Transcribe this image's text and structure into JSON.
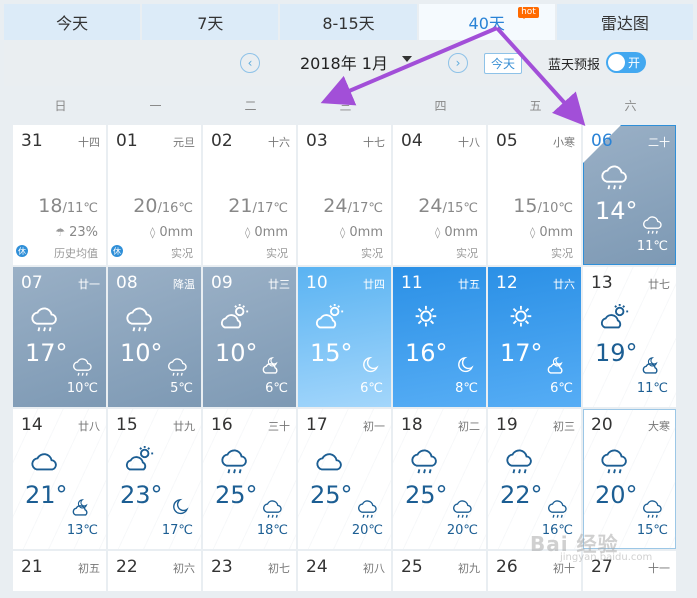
{
  "tabs": [
    {
      "label": "今天",
      "active": false
    },
    {
      "label": "7天",
      "active": false
    },
    {
      "label": "8-15天",
      "active": false
    },
    {
      "label": "40天",
      "active": true,
      "badge": "hot"
    },
    {
      "label": "雷达图",
      "active": false
    }
  ],
  "toolbar": {
    "prev_icon": "chevron-left-icon",
    "next_icon": "chevron-right-icon",
    "month": "2018年  1月",
    "today_label": "今天",
    "bluesky_label": "蓝天预报",
    "toggle_label": "开",
    "toggle_on": true
  },
  "weekdays": [
    "日",
    "一",
    "二",
    "三",
    "四",
    "五",
    "六"
  ],
  "weeks": [
    [
      {
        "day": "31",
        "lunar": "十四",
        "style": "hist",
        "temp": "18",
        "low": "/11℃",
        "rain": "23%",
        "rain_icon": "umbrella-icon",
        "src": "历史均值",
        "rest": "休"
      },
      {
        "day": "01",
        "lunar": "元旦",
        "style": "hist",
        "temp": "20",
        "low": "/16℃",
        "rain": "0mm",
        "rain_icon": "raindrop-icon",
        "src": "实况",
        "rest": "休"
      },
      {
        "day": "02",
        "lunar": "十六",
        "style": "hist",
        "temp": "21",
        "low": "/17℃",
        "rain": "0mm",
        "rain_icon": "raindrop-icon",
        "src": "实况"
      },
      {
        "day": "03",
        "lunar": "十七",
        "style": "hist",
        "temp": "24",
        "low": "/17℃",
        "rain": "0mm",
        "rain_icon": "raindrop-icon",
        "src": "实况"
      },
      {
        "day": "04",
        "lunar": "十八",
        "style": "hist",
        "temp": "24",
        "low": "/15℃",
        "rain": "0mm",
        "rain_icon": "raindrop-icon",
        "src": "实况"
      },
      {
        "day": "05",
        "lunar": "小寒",
        "style": "hist",
        "temp": "15",
        "low": "/10℃",
        "rain": "0mm",
        "rain_icon": "raindrop-icon",
        "src": "实况"
      },
      {
        "day": "06",
        "lunar": "二十",
        "style": "gray",
        "selected": true,
        "icon": "rain-cloud-icon",
        "high": "14°",
        "night_icon": "rain-cloud-icon",
        "low": "11℃"
      }
    ],
    [
      {
        "day": "07",
        "lunar": "廿一",
        "style": "gray",
        "icon": "rain-cloud-icon",
        "high": "17°",
        "night_icon": "rain-cloud-icon",
        "low": "10℃"
      },
      {
        "day": "08",
        "lunar": "降温",
        "style": "gray",
        "icon": "rain-cloud-icon",
        "high": "10°",
        "night_icon": "rain-cloud-icon",
        "low": "5℃"
      },
      {
        "day": "09",
        "lunar": "廿三",
        "style": "gray",
        "icon": "partly-cloudy-icon",
        "high": "10°",
        "night_icon": "partly-cloudy-night-icon",
        "low": "6℃"
      },
      {
        "day": "10",
        "lunar": "廿四",
        "style": "blue-light",
        "icon": "partly-cloudy-icon",
        "high": "15°",
        "night_icon": "moon-icon",
        "low": "6℃"
      },
      {
        "day": "11",
        "lunar": "廿五",
        "style": "blue",
        "icon": "sun-icon",
        "high": "16°",
        "night_icon": "moon-icon",
        "low": "8℃"
      },
      {
        "day": "12",
        "lunar": "廿六",
        "style": "blue",
        "icon": "sun-icon",
        "high": "17°",
        "night_icon": "partly-cloudy-night-icon",
        "low": "6℃"
      },
      {
        "day": "13",
        "lunar": "廿七",
        "style": "white",
        "icon": "partly-cloudy-icon",
        "high": "19°",
        "night_icon": "partly-cloudy-night-icon",
        "low": "11℃"
      }
    ],
    [
      {
        "day": "14",
        "lunar": "廿八",
        "style": "white",
        "icon": "cloud-icon",
        "high": "21°",
        "night_icon": "partly-cloudy-night-icon",
        "low": "13℃"
      },
      {
        "day": "15",
        "lunar": "廿九",
        "style": "white",
        "icon": "partly-cloudy-icon",
        "high": "23°",
        "night_icon": "moon-icon",
        "low": "17℃"
      },
      {
        "day": "16",
        "lunar": "三十",
        "style": "white",
        "icon": "rain-cloud-icon",
        "high": "25°",
        "night_icon": "rain-cloud-icon",
        "low": "18℃"
      },
      {
        "day": "17",
        "lunar": "初一",
        "style": "white",
        "icon": "cloud-icon",
        "high": "25°",
        "night_icon": "rain-cloud-icon",
        "low": "20℃"
      },
      {
        "day": "18",
        "lunar": "初二",
        "style": "white",
        "icon": "rain-cloud-icon",
        "high": "25°",
        "night_icon": "rain-cloud-icon",
        "low": "20℃"
      },
      {
        "day": "19",
        "lunar": "初三",
        "style": "white",
        "icon": "rain-cloud-icon",
        "high": "22°",
        "night_icon": "rain-cloud-icon",
        "low": "16℃"
      },
      {
        "day": "20",
        "lunar": "大寒",
        "style": "white",
        "outline": true,
        "icon": "rain-cloud-icon",
        "high": "20°",
        "night_icon": "rain-cloud-icon",
        "low": "15℃"
      }
    ],
    [
      {
        "day": "21",
        "lunar": "初五",
        "style": "short"
      },
      {
        "day": "22",
        "lunar": "初六",
        "style": "short"
      },
      {
        "day": "23",
        "lunar": "初七",
        "style": "short"
      },
      {
        "day": "24",
        "lunar": "初八",
        "style": "short"
      },
      {
        "day": "25",
        "lunar": "初九",
        "style": "short"
      },
      {
        "day": "26",
        "lunar": "初十",
        "style": "short"
      },
      {
        "day": "27",
        "lunar": "十一",
        "style": "short"
      }
    ]
  ],
  "watermark": "Bai 经验",
  "watermark_sub": "jingyan.baidu.com",
  "colors": {
    "accent": "#2a83d6",
    "arrow": "#a24fd8",
    "blue_day": "#2b90e6",
    "gray_day": "#8aa3bb",
    "hot": "#ff6a00"
  }
}
